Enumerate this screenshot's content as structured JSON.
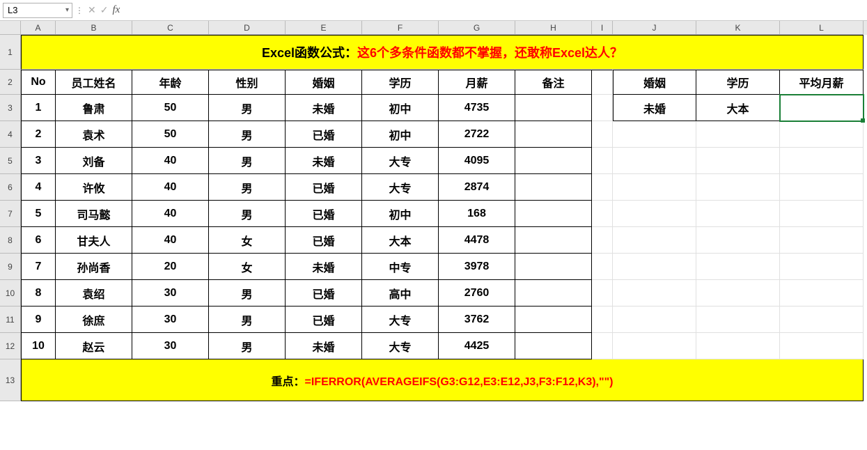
{
  "active_cell": "L3",
  "formula_value": "",
  "columns": [
    "A",
    "B",
    "C",
    "D",
    "E",
    "F",
    "G",
    "H",
    "I",
    "J",
    "K",
    "L"
  ],
  "title_prefix": "Excel函数公式：",
  "title_main": "这6个多条件函数都不掌握，还敢称Excel达人？",
  "main_headers": [
    "No",
    "员工姓名",
    "年龄",
    "性别",
    "婚姻",
    "学历",
    "月薪",
    "备注"
  ],
  "side_headers": [
    "婚姻",
    "学历",
    "平均月薪"
  ],
  "side_values": [
    "未婚",
    "大本",
    ""
  ],
  "rows": [
    {
      "no": "1",
      "name": "鲁肃",
      "age": "50",
      "gender": "男",
      "marriage": "未婚",
      "edu": "初中",
      "salary": "4735",
      "note": ""
    },
    {
      "no": "2",
      "name": "袁术",
      "age": "50",
      "gender": "男",
      "marriage": "已婚",
      "edu": "初中",
      "salary": "2722",
      "note": ""
    },
    {
      "no": "3",
      "name": "刘备",
      "age": "40",
      "gender": "男",
      "marriage": "未婚",
      "edu": "大专",
      "salary": "4095",
      "note": ""
    },
    {
      "no": "4",
      "name": "许攸",
      "age": "40",
      "gender": "男",
      "marriage": "已婚",
      "edu": "大专",
      "salary": "2874",
      "note": ""
    },
    {
      "no": "5",
      "name": "司马懿",
      "age": "40",
      "gender": "男",
      "marriage": "已婚",
      "edu": "初中",
      "salary": "168",
      "note": ""
    },
    {
      "no": "6",
      "name": "甘夫人",
      "age": "40",
      "gender": "女",
      "marriage": "已婚",
      "edu": "大本",
      "salary": "4478",
      "note": ""
    },
    {
      "no": "7",
      "name": "孙尚香",
      "age": "20",
      "gender": "女",
      "marriage": "未婚",
      "edu": "中专",
      "salary": "3978",
      "note": ""
    },
    {
      "no": "8",
      "name": "袁绍",
      "age": "30",
      "gender": "男",
      "marriage": "已婚",
      "edu": "高中",
      "salary": "2760",
      "note": ""
    },
    {
      "no": "9",
      "name": "徐庶",
      "age": "30",
      "gender": "男",
      "marriage": "已婚",
      "edu": "大专",
      "salary": "3762",
      "note": ""
    },
    {
      "no": "10",
      "name": "赵云",
      "age": "30",
      "gender": "男",
      "marriage": "未婚",
      "edu": "大专",
      "salary": "4425",
      "note": ""
    }
  ],
  "footer_label": "重点：",
  "footer_formula": "=IFERROR(AVERAGEIFS(G3:G12,E3:E12,J3,F3:F12,K3),\"\")",
  "row_heights": {
    "1": 50,
    "2": 36,
    "3": 38,
    "4": 38,
    "5": 38,
    "6": 38,
    "7": 38,
    "8": 38,
    "9": 38,
    "10": 38,
    "11": 38,
    "12": 38,
    "13": 60
  }
}
